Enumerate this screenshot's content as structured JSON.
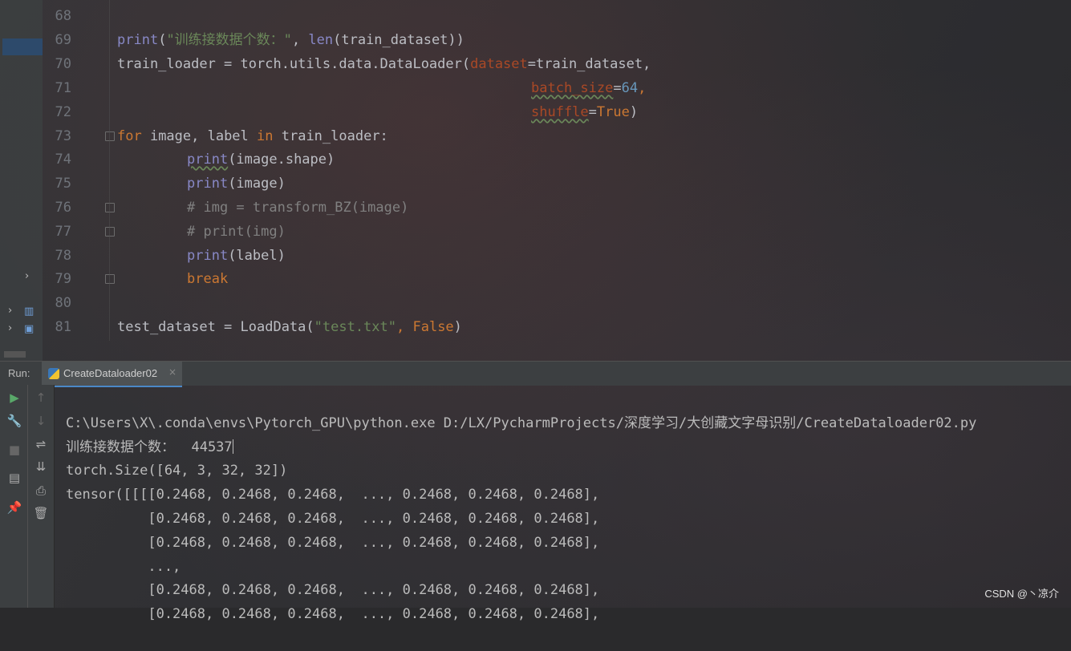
{
  "editor": {
    "lines": [
      {
        "n": "68"
      },
      {
        "n": "69"
      },
      {
        "n": "70"
      },
      {
        "n": "71"
      },
      {
        "n": "72"
      },
      {
        "n": "73"
      },
      {
        "n": "74"
      },
      {
        "n": "75"
      },
      {
        "n": "76"
      },
      {
        "n": "77"
      },
      {
        "n": "78"
      },
      {
        "n": "79"
      },
      {
        "n": "80"
      },
      {
        "n": "81"
      }
    ],
    "code": {
      "l69_print": "print",
      "l69_str": "\"训练接数据个数：\"",
      "l69_rest": ", len(train_dataset))",
      "l69_len": "len",
      "l70_a": "train_loader = torch.utils.data.DataLoader(",
      "l70_param": "dataset",
      "l70_b": "=train_dataset,",
      "l71_param": "batch_size",
      "l71_eq": "=",
      "l71_num": "64",
      "l71_comma": ",",
      "l72_param": "shuffle",
      "l72_eq": "=",
      "l72_kw": "True",
      "l72_close": ")",
      "l73_for": "for",
      "l73_mid": " image, label ",
      "l73_in": "in",
      "l73_rest": " train_loader:",
      "l74_print": "print",
      "l74_rest": "(image.shape)",
      "l75_print": "print",
      "l75_rest": "(image)",
      "l76_comment": "# img = transform_BZ(image)",
      "l77_comment": "# print(img)",
      "l78_print": "print",
      "l78_rest": "(label)",
      "l79_break": "break",
      "l81_a": "test_dataset = LoadData(",
      "l81_str": "\"test.txt\"",
      "l81_comma": ", ",
      "l81_kw": "False",
      "l81_close": ")"
    }
  },
  "run_panel": {
    "label": "Run:",
    "tab_name": "CreateDataloader02",
    "tab_close": "×"
  },
  "toolbar_icons": {
    "run": "play-icon",
    "up": "arrow-up-icon",
    "settings": "wrench-icon",
    "down": "arrow-down-icon",
    "stop": "stop-icon",
    "wrap": "soft-wrap-icon",
    "scroll_end": "scroll-to-end-icon",
    "layout": "layout-icon",
    "print": "print-icon",
    "pin": "pin-icon",
    "trash": "trash-icon"
  },
  "console": {
    "lines": [
      "C:\\Users\\X\\.conda\\envs\\Pytorch_GPU\\python.exe D:/LX/PycharmProjects/深度学习/大创藏文字母识别/CreateDataloader02.py",
      "训练接数据个数：  44537",
      "torch.Size([64, 3, 32, 32])",
      "tensor([[[[0.2468, 0.2468, 0.2468,  ..., 0.2468, 0.2468, 0.2468],",
      "          [0.2468, 0.2468, 0.2468,  ..., 0.2468, 0.2468, 0.2468],",
      "          [0.2468, 0.2468, 0.2468,  ..., 0.2468, 0.2468, 0.2468],",
      "          ...,",
      "          [0.2468, 0.2468, 0.2468,  ..., 0.2468, 0.2468, 0.2468],",
      "          [0.2468, 0.2468, 0.2468,  ..., 0.2468, 0.2468, 0.2468],"
    ]
  },
  "watermark": "CSDN @丶凉介",
  "colors": {
    "keyword": "#cc7832",
    "builtin": "#8888c6",
    "string": "#6a8759",
    "number": "#6897bb",
    "param": "#aa4926",
    "comment": "#808080",
    "text": "#bcbec4"
  }
}
